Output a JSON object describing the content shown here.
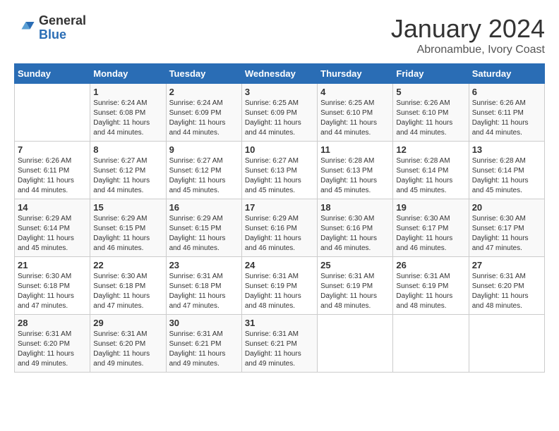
{
  "header": {
    "logo_general": "General",
    "logo_blue": "Blue",
    "month_title": "January 2024",
    "location": "Abronambue, Ivory Coast"
  },
  "days_of_week": [
    "Sunday",
    "Monday",
    "Tuesday",
    "Wednesday",
    "Thursday",
    "Friday",
    "Saturday"
  ],
  "weeks": [
    [
      {
        "day": "",
        "info": ""
      },
      {
        "day": "1",
        "info": "Sunrise: 6:24 AM\nSunset: 6:08 PM\nDaylight: 11 hours and 44 minutes."
      },
      {
        "day": "2",
        "info": "Sunrise: 6:24 AM\nSunset: 6:09 PM\nDaylight: 11 hours and 44 minutes."
      },
      {
        "day": "3",
        "info": "Sunrise: 6:25 AM\nSunset: 6:09 PM\nDaylight: 11 hours and 44 minutes."
      },
      {
        "day": "4",
        "info": "Sunrise: 6:25 AM\nSunset: 6:10 PM\nDaylight: 11 hours and 44 minutes."
      },
      {
        "day": "5",
        "info": "Sunrise: 6:26 AM\nSunset: 6:10 PM\nDaylight: 11 hours and 44 minutes."
      },
      {
        "day": "6",
        "info": "Sunrise: 6:26 AM\nSunset: 6:11 PM\nDaylight: 11 hours and 44 minutes."
      }
    ],
    [
      {
        "day": "7",
        "info": ""
      },
      {
        "day": "8",
        "info": "Sunrise: 6:27 AM\nSunset: 6:12 PM\nDaylight: 11 hours and 44 minutes."
      },
      {
        "day": "9",
        "info": "Sunrise: 6:27 AM\nSunset: 6:12 PM\nDaylight: 11 hours and 45 minutes."
      },
      {
        "day": "10",
        "info": "Sunrise: 6:27 AM\nSunset: 6:13 PM\nDaylight: 11 hours and 45 minutes."
      },
      {
        "day": "11",
        "info": "Sunrise: 6:28 AM\nSunset: 6:13 PM\nDaylight: 11 hours and 45 minutes."
      },
      {
        "day": "12",
        "info": "Sunrise: 6:28 AM\nSunset: 6:14 PM\nDaylight: 11 hours and 45 minutes."
      },
      {
        "day": "13",
        "info": "Sunrise: 6:28 AM\nSunset: 6:14 PM\nDaylight: 11 hours and 45 minutes."
      }
    ],
    [
      {
        "day": "14",
        "info": ""
      },
      {
        "day": "15",
        "info": "Sunrise: 6:29 AM\nSunset: 6:15 PM\nDaylight: 11 hours and 46 minutes."
      },
      {
        "day": "16",
        "info": "Sunrise: 6:29 AM\nSunset: 6:15 PM\nDaylight: 11 hours and 46 minutes."
      },
      {
        "day": "17",
        "info": "Sunrise: 6:29 AM\nSunset: 6:16 PM\nDaylight: 11 hours and 46 minutes."
      },
      {
        "day": "18",
        "info": "Sunrise: 6:30 AM\nSunset: 6:16 PM\nDaylight: 11 hours and 46 minutes."
      },
      {
        "day": "19",
        "info": "Sunrise: 6:30 AM\nSunset: 6:17 PM\nDaylight: 11 hours and 46 minutes."
      },
      {
        "day": "20",
        "info": "Sunrise: 6:30 AM\nSunset: 6:17 PM\nDaylight: 11 hours and 47 minutes."
      }
    ],
    [
      {
        "day": "21",
        "info": ""
      },
      {
        "day": "22",
        "info": "Sunrise: 6:30 AM\nSunset: 6:18 PM\nDaylight: 11 hours and 47 minutes."
      },
      {
        "day": "23",
        "info": "Sunrise: 6:31 AM\nSunset: 6:18 PM\nDaylight: 11 hours and 47 minutes."
      },
      {
        "day": "24",
        "info": "Sunrise: 6:31 AM\nSunset: 6:19 PM\nDaylight: 11 hours and 48 minutes."
      },
      {
        "day": "25",
        "info": "Sunrise: 6:31 AM\nSunset: 6:19 PM\nDaylight: 11 hours and 48 minutes."
      },
      {
        "day": "26",
        "info": "Sunrise: 6:31 AM\nSunset: 6:19 PM\nDaylight: 11 hours and 48 minutes."
      },
      {
        "day": "27",
        "info": "Sunrise: 6:31 AM\nSunset: 6:20 PM\nDaylight: 11 hours and 48 minutes."
      }
    ],
    [
      {
        "day": "28",
        "info": "Sunrise: 6:31 AM\nSunset: 6:20 PM\nDaylight: 11 hours and 49 minutes."
      },
      {
        "day": "29",
        "info": "Sunrise: 6:31 AM\nSunset: 6:20 PM\nDaylight: 11 hours and 49 minutes."
      },
      {
        "day": "30",
        "info": "Sunrise: 6:31 AM\nSunset: 6:21 PM\nDaylight: 11 hours and 49 minutes."
      },
      {
        "day": "31",
        "info": "Sunrise: 6:31 AM\nSunset: 6:21 PM\nDaylight: 11 hours and 49 minutes."
      },
      {
        "day": "",
        "info": ""
      },
      {
        "day": "",
        "info": ""
      },
      {
        "day": "",
        "info": ""
      }
    ]
  ]
}
